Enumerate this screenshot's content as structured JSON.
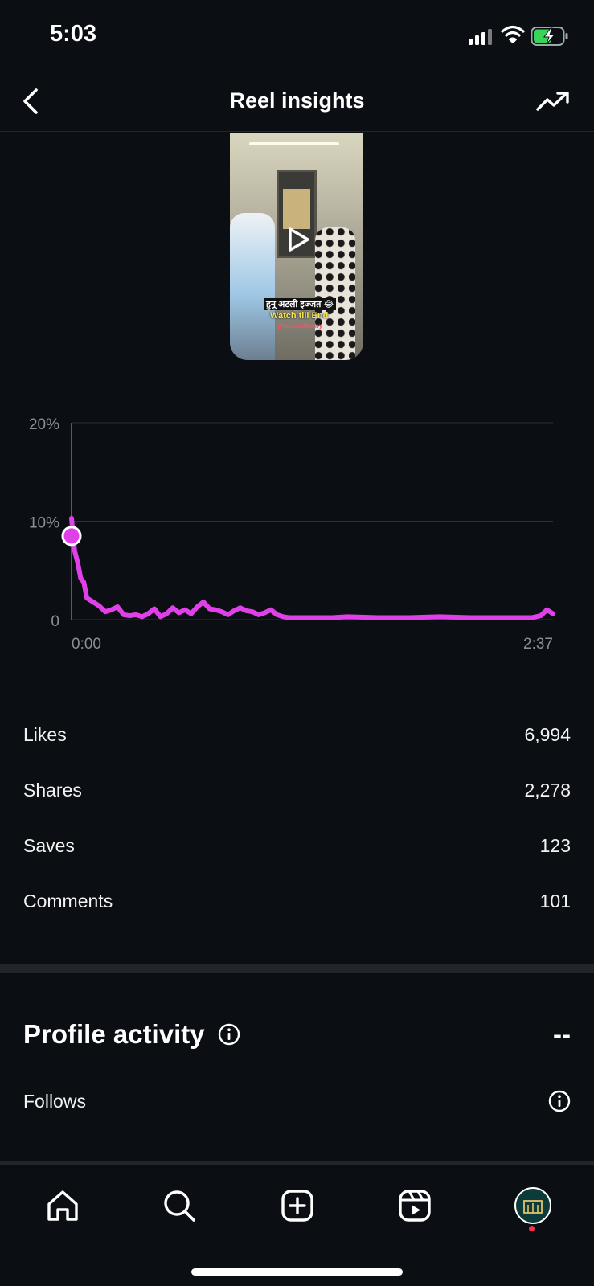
{
  "status_bar": {
    "time": "5:03"
  },
  "header": {
    "title": "Reel insights"
  },
  "thumbnail": {
    "caption_line1": "हुनू अटली इज्जत 😂",
    "caption_line2": "Watch till End",
    "caption_line3": "@mosaicfunny"
  },
  "chart_data": {
    "type": "line",
    "y_ticks": [
      "20%",
      "10%",
      "0"
    ],
    "x_ticks": [
      "0:00",
      "2:37"
    ],
    "ylim": [
      0,
      20
    ],
    "xlim": [
      0,
      157
    ],
    "color": "#e040e8",
    "grid": true,
    "series": [
      {
        "x": [
          0,
          0.5,
          1,
          2,
          3,
          4,
          5,
          7,
          9,
          11,
          13,
          15,
          17,
          19,
          21,
          23,
          25,
          27,
          29,
          31,
          33,
          35,
          37,
          39,
          41,
          43,
          45,
          47,
          49,
          51,
          53,
          55,
          57,
          59,
          61,
          63,
          65,
          67,
          69,
          71,
          73,
          75,
          77,
          80,
          85,
          90,
          100,
          110,
          120,
          130,
          140,
          150,
          153,
          155,
          157
        ],
        "y": [
          10.3,
          8.5,
          7.0,
          5.8,
          4.2,
          3.8,
          2.2,
          1.8,
          1.4,
          0.8,
          1.0,
          1.3,
          0.5,
          0.4,
          0.5,
          0.3,
          0.6,
          1.1,
          0.3,
          0.6,
          1.2,
          0.7,
          1.0,
          0.6,
          1.3,
          1.8,
          1.1,
          1.0,
          0.8,
          0.5,
          0.9,
          1.2,
          0.9,
          0.8,
          0.5,
          0.7,
          1.0,
          0.5,
          0.3,
          0.2,
          0.2,
          0.2,
          0.2,
          0.2,
          0.2,
          0.3,
          0.2,
          0.2,
          0.3,
          0.2,
          0.2,
          0.2,
          0.4,
          1.0,
          0.6
        ]
      }
    ],
    "marker": {
      "x": 0,
      "y": 8.5
    }
  },
  "metrics": [
    {
      "label": "Likes",
      "value": "6,994"
    },
    {
      "label": "Shares",
      "value": "2,278"
    },
    {
      "label": "Saves",
      "value": "123"
    },
    {
      "label": "Comments",
      "value": "101"
    }
  ],
  "profile_activity": {
    "title": "Profile activity",
    "value": "--",
    "follows_label": "Follows"
  },
  "colors": {
    "accent": "#e040e8",
    "background": "#0b0f14",
    "notification": "#ff2d4f"
  },
  "icons": [
    "back-arrow-icon",
    "trending-icon",
    "play-icon",
    "info-icon",
    "home-icon",
    "search-icon",
    "create-icon",
    "reels-icon",
    "profile-avatar"
  ]
}
